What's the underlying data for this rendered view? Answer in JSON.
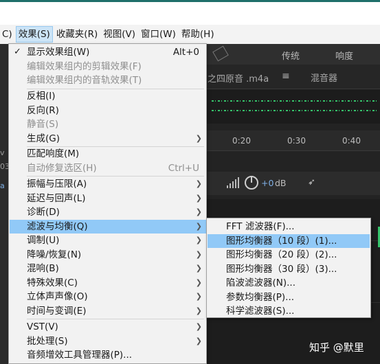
{
  "menubar": {
    "items": [
      "C)",
      "效果(S)",
      "收藏夹(R)",
      "视图(V)",
      "窗口(W)",
      "帮助(H)"
    ]
  },
  "toolbar": {
    "tab1": "传统",
    "tab2": "响度"
  },
  "tabbar": {
    "file_name": "之四原音 .m4a",
    "menu_glyph": "≡",
    "mixer": "混音器"
  },
  "ruler": {
    "ticks": [
      "0:20",
      "0:30",
      "0:40"
    ]
  },
  "track": {
    "db_value": "+0",
    "db_unit": "dB",
    "pin_glyph": "➶"
  },
  "gutter": {
    "v": "v",
    "d3": "03",
    "a": "a"
  },
  "effects_menu": {
    "items": [
      {
        "label": "显示效果组(W)",
        "shortcut": "Alt+0",
        "checked": true,
        "disabled": false
      },
      {
        "label": "编辑效果组内的剪辑效果(F)",
        "disabled": true
      },
      {
        "label": "编辑效果组内的音轨效果(T)",
        "disabled": true
      },
      {
        "label": "反相(I)",
        "disabled": false
      },
      {
        "label": "反向(R)",
        "disabled": false
      },
      {
        "label": "静音(S)",
        "disabled": true
      },
      {
        "label": "生成(G)",
        "submenu": true
      },
      {
        "label": "匹配响度(M)",
        "disabled": false
      },
      {
        "label": "自动修复选区(H)",
        "shortcut": "Ctrl+U",
        "disabled": true
      },
      {
        "label": "振幅与压限(A)",
        "submenu": true
      },
      {
        "label": "延迟与回声(L)",
        "submenu": true
      },
      {
        "label": "诊断(D)",
        "submenu": true
      },
      {
        "label": "滤波与均衡(Q)",
        "submenu": true,
        "highlight": true
      },
      {
        "label": "调制(U)",
        "submenu": true
      },
      {
        "label": "降噪/恢复(N)",
        "submenu": true
      },
      {
        "label": "混响(B)",
        "submenu": true
      },
      {
        "label": "特殊效果(C)",
        "submenu": true
      },
      {
        "label": "立体声声像(O)",
        "submenu": true
      },
      {
        "label": "时间与变调(E)",
        "submenu": true
      },
      {
        "label": "VST(V)",
        "submenu": true
      },
      {
        "label": "批处理(S)",
        "submenu": true
      },
      {
        "label": "音频增效工具管理器(P)..."
      }
    ]
  },
  "filter_submenu": {
    "items": [
      {
        "label": "FFT 滤波器(F)..."
      },
      {
        "label": "图形均衡器（10 段）(1)...",
        "highlight": true
      },
      {
        "label": "图形均衡器（20 段）(2)..."
      },
      {
        "label": "图形均衡器（30 段）(3)..."
      },
      {
        "label": "陷波滤波器(N)..."
      },
      {
        "label": "参数均衡器(P)..."
      },
      {
        "label": "科学滤波器(S)..."
      }
    ]
  },
  "watermark": "知乎 @默里",
  "colors": {
    "highlight": "#91c9f7",
    "menubar_active": "#cce4f7",
    "waveform": "#36c36b",
    "accent_strip": "#1f6f6a"
  }
}
